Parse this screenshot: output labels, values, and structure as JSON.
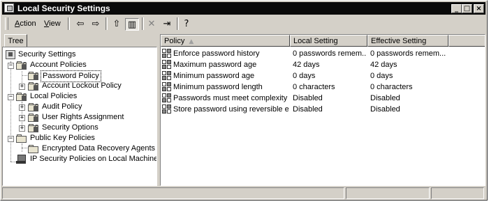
{
  "window": {
    "title": "Local Security Settings"
  },
  "window_controls": {
    "minimize": "_",
    "maximize": "□",
    "close": "×"
  },
  "menu": {
    "action_rest": "ction",
    "action_key": "A",
    "view_rest": "iew",
    "view_key": "V"
  },
  "toolbar": {
    "buttons": [
      {
        "name": "back-icon",
        "glyph": "⇦"
      },
      {
        "name": "forward-icon",
        "glyph": "⇨"
      },
      {
        "name": "up-one-level-icon",
        "glyph": "⇧"
      },
      {
        "name": "show-hide-tree-icon",
        "glyph": "▥"
      },
      {
        "name": "delete-icon",
        "glyph": "✕"
      },
      {
        "name": "export-list-icon",
        "glyph": "⇥"
      },
      {
        "name": "help-icon",
        "glyph": "?"
      }
    ]
  },
  "tree": {
    "tab_label": "Tree",
    "nodes": [
      {
        "label": "Security Settings"
      },
      {
        "label": "Account Policies"
      },
      {
        "label": "Password Policy"
      },
      {
        "label": "Account Lockout Policy"
      },
      {
        "label": "Local Policies"
      },
      {
        "label": "Audit Policy"
      },
      {
        "label": "User Rights Assignment"
      },
      {
        "label": "Security Options"
      },
      {
        "label": "Public Key Policies"
      },
      {
        "label": "Encrypted Data Recovery Agents"
      },
      {
        "label": "IP Security Policies on Local Machine"
      }
    ],
    "selected": "Password Policy"
  },
  "list": {
    "columns": [
      {
        "label": "Policy"
      },
      {
        "label": "Local Setting"
      },
      {
        "label": "Effective Setting"
      }
    ],
    "rows": [
      {
        "policy": "Enforce password history",
        "local": "0 passwords remem...",
        "effective": "0 passwords remem..."
      },
      {
        "policy": "Maximum password age",
        "local": "42 days",
        "effective": "42 days"
      },
      {
        "policy": "Minimum password age",
        "local": "0 days",
        "effective": "0 days"
      },
      {
        "policy": "Minimum password length",
        "local": "0 characters",
        "effective": "0 characters"
      },
      {
        "policy": "Passwords must meet complexity r...",
        "local": "Disabled",
        "effective": "Disabled"
      },
      {
        "policy": "Store password using reversible e...",
        "local": "Disabled",
        "effective": "Disabled"
      }
    ]
  },
  "status": {
    "panels": [
      "",
      "",
      "",
      ""
    ]
  }
}
